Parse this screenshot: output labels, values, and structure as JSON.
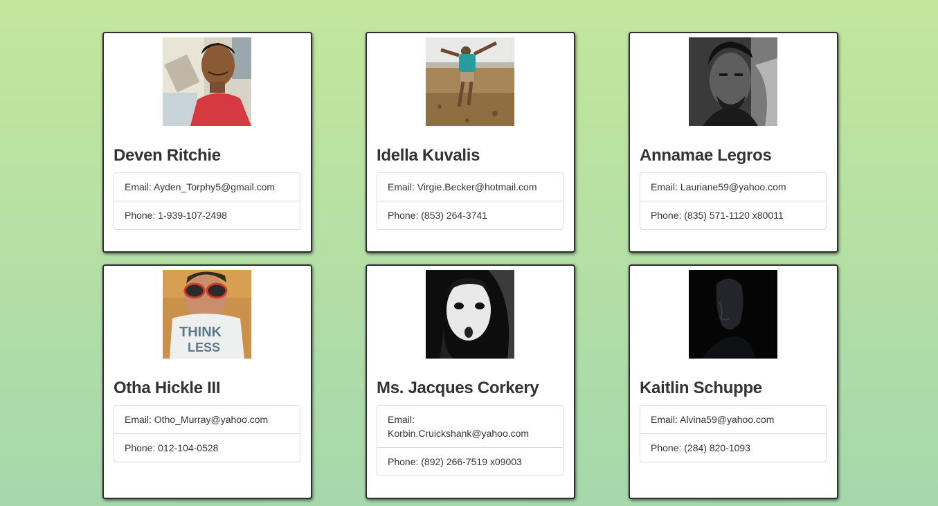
{
  "contacts": [
    {
      "name": "Deven Ritchie",
      "email_label": "Email:",
      "email": "Ayden_Torphy5@gmail.com",
      "phone_label": "Phone:",
      "phone": "1-939-107-2498",
      "photo_alt": "Portrait of man smiling in red shirt"
    },
    {
      "name": "Idella Kuvalis",
      "email_label": "Email:",
      "email": "Virgie.Becker@hotmail.com",
      "phone_label": "Phone:",
      "phone": "(853) 264-3741",
      "photo_alt": "Person jumping on a beach"
    },
    {
      "name": "Annamae Legros",
      "email_label": "Email:",
      "email": "Lauriane59@yahoo.com",
      "phone_label": "Phone:",
      "phone": "(835) 571-1120 x80011",
      "photo_alt": "Black and white portrait of man"
    },
    {
      "name": "Otha Hickle III",
      "email_label": "Email:",
      "email": "Otho_Murray@yahoo.com",
      "phone_label": "Phone:",
      "phone": "012-104-0528",
      "photo_alt": "Man with sunglasses in printed t-shirt"
    },
    {
      "name": "Ms. Jacques Corkery",
      "email_label": "Email:",
      "email": "Korbin.Cruickshank@yahoo.com",
      "phone_label": "Phone:",
      "phone": "(892) 266-7519 x09003",
      "photo_alt": "Black and white portrait with hood"
    },
    {
      "name": "Kaitlin Schuppe",
      "email_label": "Email:",
      "email": "Alvina59@yahoo.com",
      "phone_label": "Phone:",
      "phone": "(284) 820-1093",
      "photo_alt": "Dark portrait of man in profile"
    }
  ]
}
